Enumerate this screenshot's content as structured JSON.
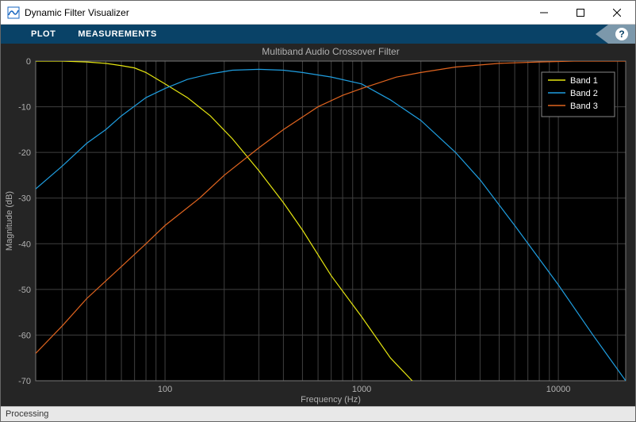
{
  "window": {
    "title": "Dynamic Filter Visualizer"
  },
  "toolbar": {
    "tabs": [
      "PLOT",
      "MEASUREMENTS"
    ],
    "help": "?"
  },
  "status": {
    "text": "Processing"
  },
  "chart_data": {
    "type": "line",
    "title": "Multiband Audio Crossover Filter",
    "xlabel": "Frequency (Hz)",
    "ylabel": "Magnitude (dB)",
    "xscale": "log",
    "xlim": [
      22,
      22000
    ],
    "ylim": [
      -70,
      0
    ],
    "xticks": [
      100,
      1000,
      10000
    ],
    "yticks": [
      -70,
      -60,
      -50,
      -40,
      -30,
      -20,
      -10,
      0
    ],
    "legend": {
      "position": "upper-right",
      "entries": [
        "Band 1",
        "Band 2",
        "Band 3"
      ]
    },
    "colors": {
      "Band 1": "#e5e510",
      "Band 2": "#1f9ee0",
      "Band 3": "#e0641f"
    },
    "series": [
      {
        "name": "Band 1",
        "x": [
          22,
          30,
          40,
          50,
          60,
          70,
          80,
          100,
          130,
          170,
          220,
          300,
          400,
          500,
          700,
          1000,
          1400,
          2000,
          2100
        ],
        "y": [
          0,
          0,
          -0.2,
          -0.5,
          -1,
          -1.5,
          -2.5,
          -5,
          -8,
          -12,
          -17,
          -24,
          -31,
          -37,
          -47,
          -56,
          -65,
          -72,
          -73
        ]
      },
      {
        "name": "Band 2",
        "x": [
          22,
          30,
          40,
          50,
          60,
          80,
          100,
          130,
          170,
          220,
          300,
          400,
          500,
          700,
          1000,
          1400,
          2000,
          3000,
          4000,
          6000,
          10000,
          15000,
          22000
        ],
        "y": [
          -28,
          -23,
          -18,
          -15,
          -12,
          -8,
          -6,
          -4,
          -2.8,
          -2,
          -1.8,
          -2,
          -2.5,
          -3.5,
          -5,
          -8.5,
          -13,
          -20,
          -26,
          -36,
          -49,
          -60,
          -70
        ]
      },
      {
        "name": "Band 3",
        "x": [
          22,
          30,
          40,
          60,
          80,
          100,
          150,
          200,
          300,
          400,
          600,
          800,
          1000,
          1500,
          2000,
          3000,
          5000,
          8000,
          12000,
          22000
        ],
        "y": [
          -64,
          -58,
          -52,
          -45,
          -40,
          -36,
          -30,
          -25,
          -19,
          -15,
          -10,
          -7.5,
          -6,
          -3.5,
          -2.5,
          -1.3,
          -0.5,
          -0.2,
          0,
          0
        ]
      }
    ]
  }
}
